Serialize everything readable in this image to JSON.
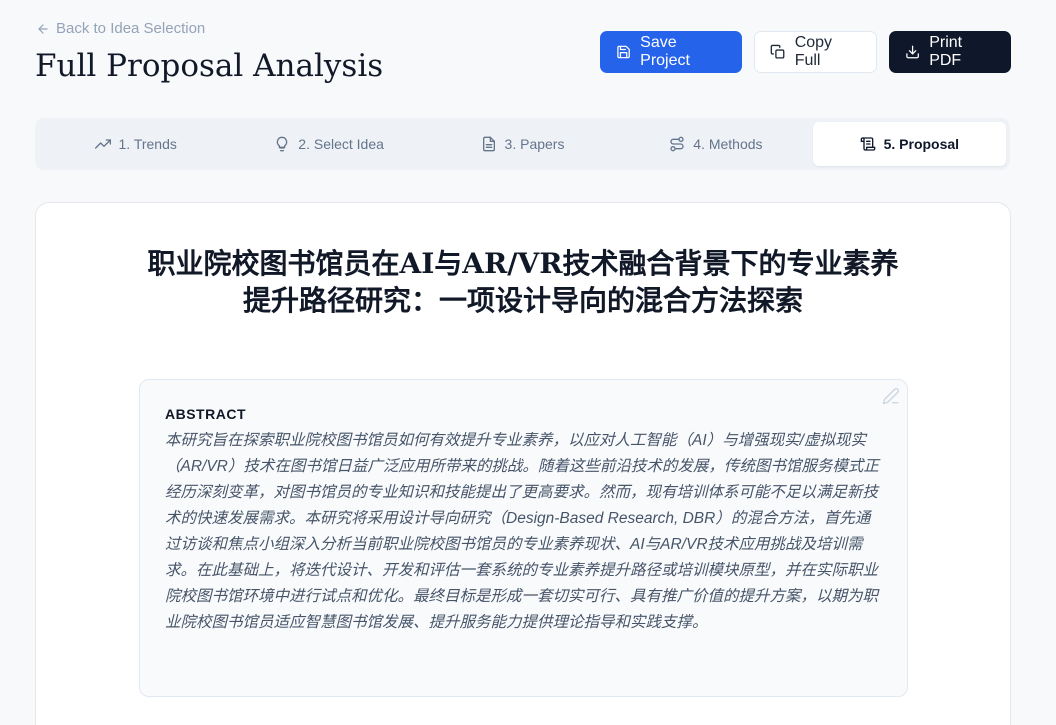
{
  "header": {
    "back_label": "Back to Idea Selection",
    "title": "Full Proposal Analysis",
    "save_label": "Save Project",
    "copy_label": "Copy Full",
    "print_label": "Print PDF"
  },
  "tabs": [
    {
      "label": "1. Trends",
      "icon": "trending-up-icon",
      "active": false
    },
    {
      "label": "2. Select Idea",
      "icon": "lightbulb-icon",
      "active": false
    },
    {
      "label": "3. Papers",
      "icon": "document-icon",
      "active": false
    },
    {
      "label": "4. Methods",
      "icon": "route-icon",
      "active": false
    },
    {
      "label": "5. Proposal",
      "icon": "scroll-icon",
      "active": true
    }
  ],
  "proposal": {
    "title": "职业院校图书馆员在AI与AR/VR技术融合背景下的专业素养提升路径研究：一项设计导向的混合方法探索",
    "abstract_label": "ABSTRACT",
    "abstract_text": "本研究旨在探索职业院校图书馆员如何有效提升专业素养，以应对人工智能（AI）与增强现实/虚拟现实（AR/VR）技术在图书馆日益广泛应用所带来的挑战。随着这些前沿技术的发展，传统图书馆服务模式正经历深刻变革，对图书馆员的专业知识和技能提出了更高要求。然而，现有培训体系可能不足以满足新技术的快速发展需求。本研究将采用设计导向研究（Design-Based Research, DBR）的混合方法，首先通过访谈和焦点小组深入分析当前职业院校图书馆员的专业素养现状、AI与AR/VR技术应用挑战及培训需求。在此基础上，将迭代设计、开发和评估一套系统的专业素养提升路径或培训模块原型，并在实际职业院校图书馆环境中进行试点和优化。最终目标是形成一套切实可行、具有推广价值的提升方案，以期为职业院校图书馆员适应智慧图书馆发展、提升服务能力提供理论指导和实践支撑。"
  },
  "colors": {
    "primary": "#2563eb",
    "dark": "#0f172a",
    "muted": "#94a3b8"
  }
}
